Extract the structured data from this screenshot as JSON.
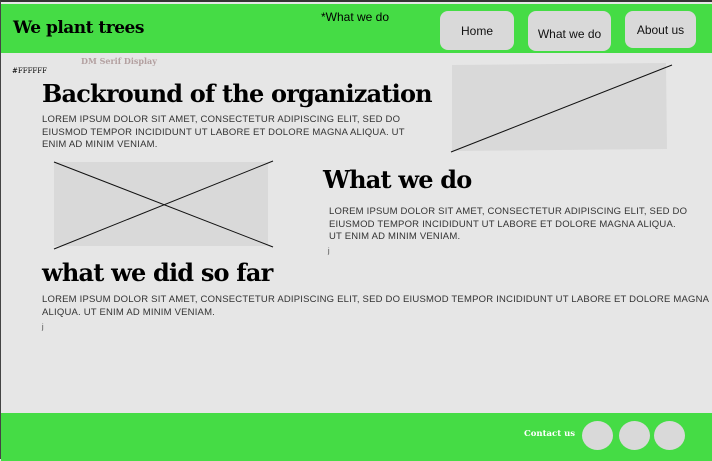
{
  "header": {
    "logo": "We plant trees",
    "note": "*What we do",
    "nav": [
      "Home",
      "What we do",
      "About us"
    ]
  },
  "annotations": {
    "font_note": "DM Serif Display",
    "color_note": "#FFFFFF"
  },
  "sections": [
    {
      "title": "Backround of the organization",
      "body": "Lorem ipsum dolor sit amet, consectetur adipiscing elit, sed do eiusmod tempor incididunt ut labore et dolore magna aliqua. Ut enim ad minim veniam."
    },
    {
      "title": "What we do",
      "body": "Lorem ipsum dolor sit amet, consectetur adipiscing elit, sed do eiusmod tempor incididunt ut labore et dolore magna aliqua. Ut enim ad minim veniam.",
      "mark": "j"
    },
    {
      "title": "what we did so far",
      "body": "Lorem ipsum dolor sit amet, consectetur adipiscing elit, sed do eiusmod tempor incididunt ut labore et dolore magna aliqua. Ut enim ad minim veniam.",
      "mark": "j"
    }
  ],
  "footer": {
    "contact": "Contact us"
  },
  "colors": {
    "brand": "#45dc45",
    "placeholder": "#d9d9d9",
    "bg": "#e6e6e6"
  }
}
